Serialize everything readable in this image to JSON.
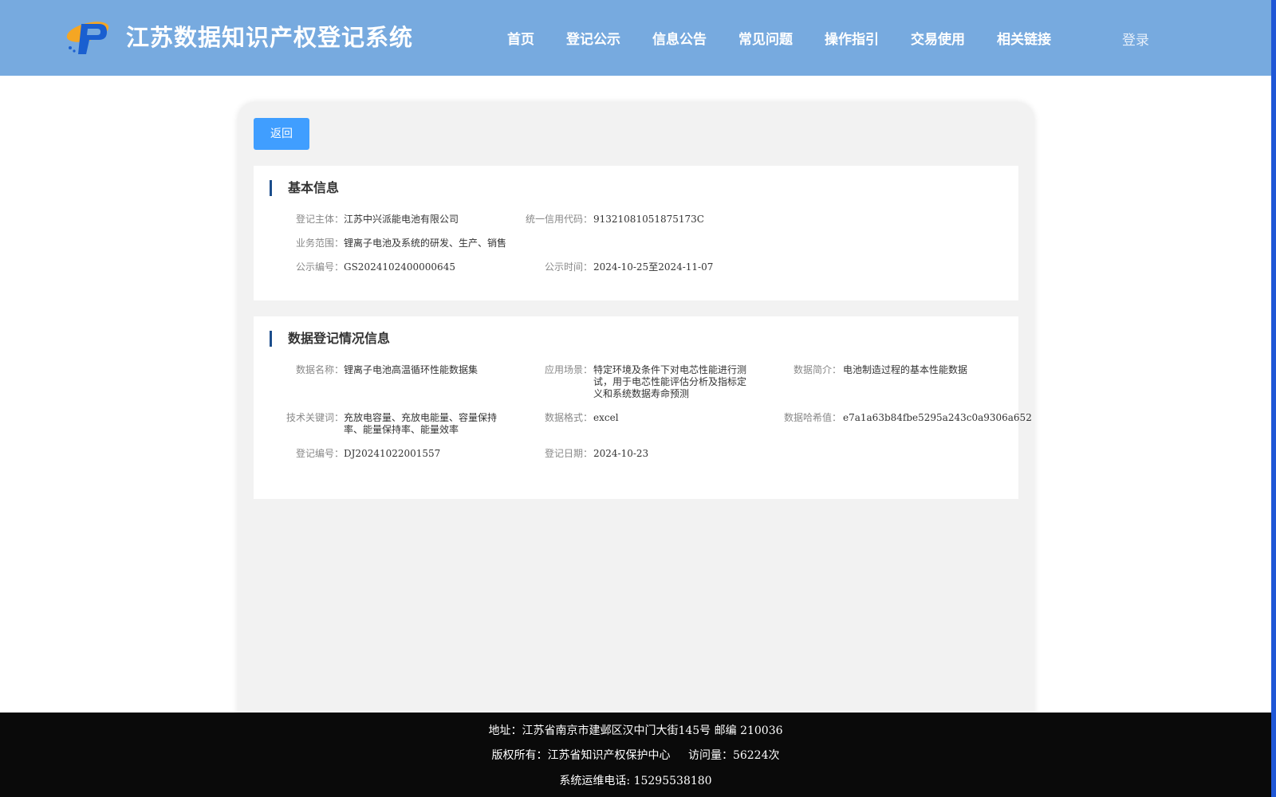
{
  "header": {
    "title": "江苏数据知识产权登记系统",
    "nav": [
      {
        "label": "首页"
      },
      {
        "label": "登记公示"
      },
      {
        "label": "信息公告"
      },
      {
        "label": "常见问题"
      },
      {
        "label": "操作指引"
      },
      {
        "label": "交易使用"
      },
      {
        "label": "相关链接"
      }
    ],
    "login_label": "登录"
  },
  "back_label": "返回",
  "basic_info": {
    "title": "基本信息",
    "fields": [
      {
        "label": "登记主体：",
        "value": "江苏中兴派能电池有限公司"
      },
      {
        "label": "统一信用代码：",
        "value": "91321081051875173C"
      },
      {
        "label": "业务范围：",
        "value": "锂离子电池及系统的研发、生产、销售"
      },
      {
        "label": "公示编号：",
        "value": "GS2024102400000645"
      },
      {
        "label": "公示时间：",
        "value": "2024-10-25至2024-11-07"
      }
    ]
  },
  "registration_info": {
    "title": "数据登记情况信息",
    "fields": [
      {
        "label": "数据名称：",
        "value": "锂离子电池高温循环性能数据集"
      },
      {
        "label": "应用场景：",
        "value": "特定环境及条件下对电芯性能进行测试，用于电芯性能评估分析及指标定义和系统数据寿命预测"
      },
      {
        "label": "数据简介：",
        "value": "电池制造过程的基本性能数据"
      },
      {
        "label": "技术关键词：",
        "value": "充放电容量、充放电能量、容量保持率、能量保持率、能量效率"
      },
      {
        "label": "数据格式：",
        "value": "excel"
      },
      {
        "label": "数据哈希值：",
        "value": "e7a1a63b84fbe5295a243c0a9306a652"
      },
      {
        "label": "登记编号：",
        "value": "DJ20241022001557"
      },
      {
        "label": "登记日期：",
        "value": "2024-10-23"
      }
    ]
  },
  "footer": {
    "address": "地址：江苏省南京市建邺区汉中门大街145号 邮编 210036",
    "copyright": "版权所有：江苏省知识产权保护中心",
    "visits": "访问量：56224次",
    "phone": "系统运维电话: 15295538180"
  },
  "colors": {
    "header_bg": "#77aadf",
    "button": "#409eff",
    "title_bar": "#1c4e8c",
    "footer_bg": "#0a0a0a"
  }
}
